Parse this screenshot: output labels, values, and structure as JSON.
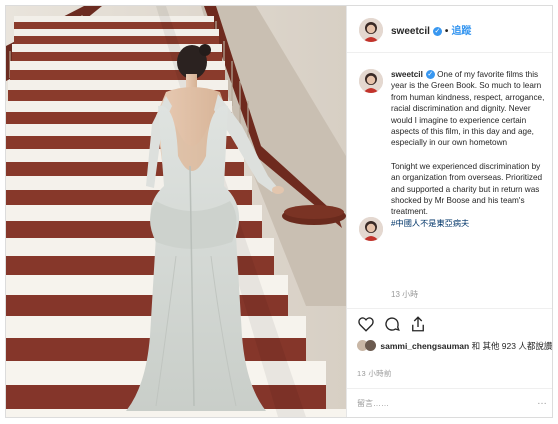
{
  "post": {
    "username": "sweetcil",
    "follow_label": "追蹤",
    "caption_user": "sweetcil",
    "caption_p1": "One of my favorite films this year is the Green Book. So much to learn from human kindness, respect, arrogance, racial discrimination and dignity. Never would I imagine to experience certain aspects of this film, in this day and age, especially in our own hometown",
    "caption_p2": "Tonight we experienced discrimination by an organization from overseas. Prioritized and supported a charity but in return was shocked by Mr Boose and his team's treatment.",
    "hashtag": "#中國人不是東亞病夫",
    "comment_time": "13 小時",
    "likes_user": "sammi_chengsauman",
    "likes_text": "和 其他 923 人都說讚",
    "post_time": "13 小時前",
    "add_comment_placeholder": "留言……",
    "more_glyph": "…"
  },
  "colors": {
    "link_blue": "#3897f0",
    "hashtag": "#003569",
    "stair_red": "#8a3b2c",
    "stair_marble": "#f2efe9"
  },
  "icons": [
    "verified-badge-icon",
    "heart-icon",
    "comment-icon",
    "share-icon"
  ]
}
